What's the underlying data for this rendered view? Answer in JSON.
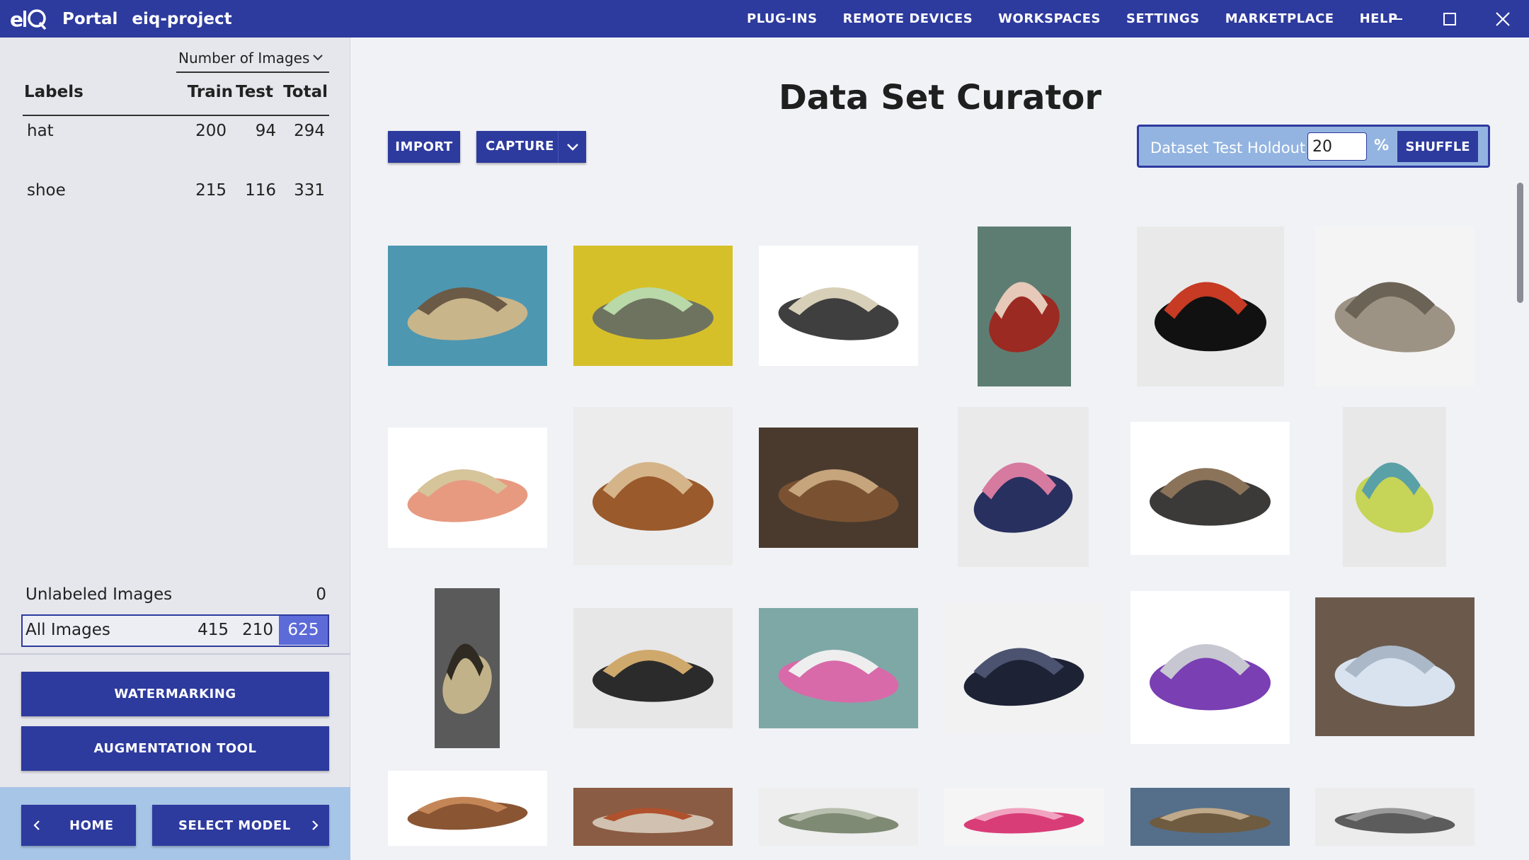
{
  "app": {
    "logo_text": "eIQ",
    "portal_label": "Portal",
    "project_name": "eiq-project",
    "accent_color": "#2d3a9e"
  },
  "nav": {
    "items": [
      "PLUG-INS",
      "REMOTE DEVICES",
      "WORKSPACES",
      "SETTINGS",
      "MARKETPLACE",
      "HELP"
    ]
  },
  "window_controls": [
    "minimize-icon",
    "maximize-icon",
    "close-icon"
  ],
  "sidebar": {
    "metric_select": "Number of Images",
    "table": {
      "headers": {
        "label": "Labels",
        "train": "Train",
        "test": "Test",
        "total": "Total"
      },
      "rows": [
        {
          "label": "hat",
          "train": "200",
          "test": "94",
          "total": "294"
        },
        {
          "label": "shoe",
          "train": "215",
          "test": "116",
          "total": "331"
        }
      ]
    },
    "unlabeled": {
      "label": "Unlabeled Images",
      "total": "0"
    },
    "all_images": {
      "label": "All Images",
      "train": "415",
      "test": "210",
      "total": "625"
    },
    "watermarking_label": "WATERMARKING",
    "augmentation_label": "AUGMENTATION TOOL",
    "home_label": "HOME",
    "select_model_label": "SELECT MODEL"
  },
  "main": {
    "title": "Data Set Curator",
    "import_label": "IMPORT",
    "capture_label": "CAPTURE",
    "holdout": {
      "label": "Dataset Test Holdout",
      "value": "20",
      "unit": "%",
      "shuffle_label": "SHUFFLE"
    },
    "images": [
      {
        "subject": "sandal"
      },
      {
        "subject": "slipper"
      },
      {
        "subject": "sandal"
      },
      {
        "subject": "flip-flop"
      },
      {
        "subject": "flip-flops"
      },
      {
        "subject": "sandal"
      },
      {
        "subject": "flip-flops"
      },
      {
        "subject": "wedge-sandals"
      },
      {
        "subject": "heel"
      },
      {
        "subject": "flip-flop"
      },
      {
        "subject": "sandal"
      },
      {
        "subject": "flip-flop"
      },
      {
        "subject": "slipper"
      },
      {
        "subject": "wedge"
      },
      {
        "subject": "sandal"
      },
      {
        "subject": "slide"
      },
      {
        "subject": "high-heel"
      },
      {
        "subject": "flip-flops"
      },
      {
        "subject": "slide"
      },
      {
        "subject": "sandal"
      },
      {
        "subject": "sandal"
      },
      {
        "subject": "shoe"
      },
      {
        "subject": "sandal"
      },
      {
        "subject": "sandal"
      }
    ]
  }
}
